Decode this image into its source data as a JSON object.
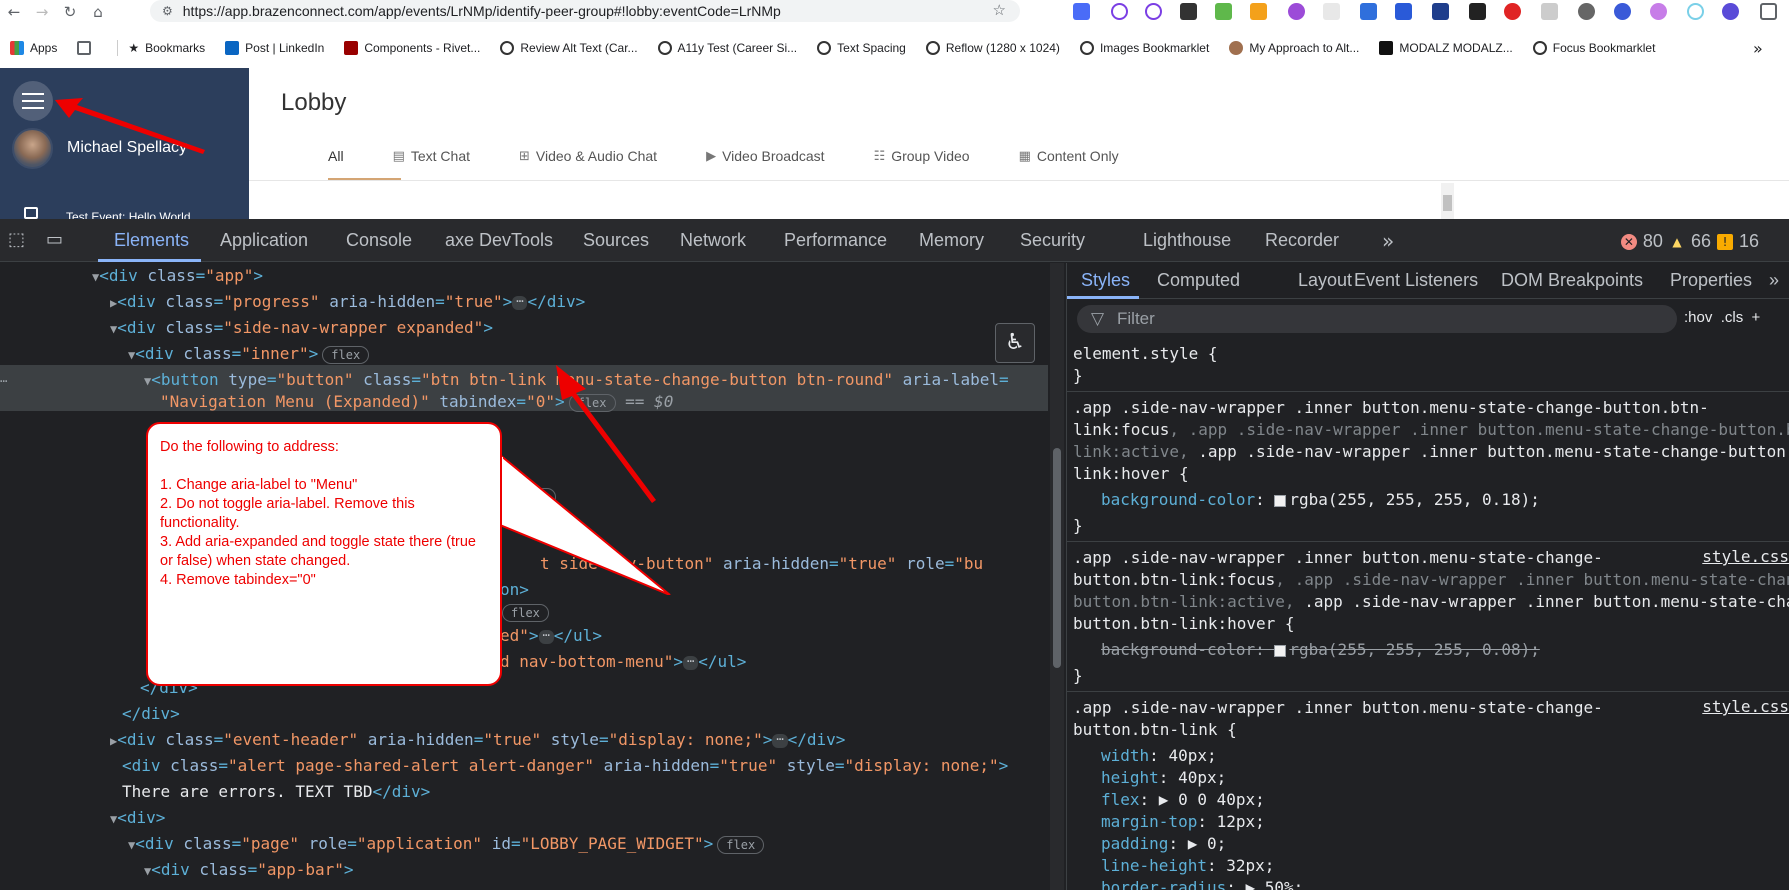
{
  "browser": {
    "url": "https://app.brazenconnect.com/app/events/LrNMp/identify-peer-group#!lobby:eventCode=LrNMp",
    "bookmarks": [
      "Apps",
      "Bookmarks",
      "Post | LinkedIn",
      "Components - Rivet...",
      "Review Alt Text (Car...",
      "A11y Test (Career Si...",
      "Text Spacing",
      "Reflow (1280 x 1024)",
      "Images Bookmarklet",
      "My Approach to Alt...",
      "MODALZ MODALZ...",
      "Focus Bookmarklet"
    ]
  },
  "app": {
    "user_name": "Michael Spellacy",
    "event_name": "Test Event: Hello World",
    "page_title": "Lobby",
    "tabs": [
      {
        "label": "All",
        "icon": ""
      },
      {
        "label": "Text Chat",
        "icon": "chat-icon"
      },
      {
        "label": "Video & Audio Chat",
        "icon": "video-chat-icon"
      },
      {
        "label": "Video Broadcast",
        "icon": "broadcast-icon"
      },
      {
        "label": "Group Video",
        "icon": "group-icon"
      },
      {
        "label": "Content Only",
        "icon": "document-icon"
      }
    ]
  },
  "devtools": {
    "tabs": [
      "Elements",
      "Application",
      "Console",
      "axe DevTools",
      "Sources",
      "Network",
      "Performance",
      "Memory",
      "Security",
      "Lighthouse",
      "Recorder"
    ],
    "errors": "80",
    "warnings": "66",
    "issues": "16",
    "styles_tabs": [
      "Styles",
      "Computed",
      "Layout",
      "Event Listeners",
      "DOM Breakpoints",
      "Properties"
    ],
    "filter_placeholder": "Filter",
    "hov": ":hov",
    "cls": ".cls",
    "source": "style.css"
  },
  "callout": {
    "heading": "Do the following to address:",
    "items": [
      "1. Change aria-label to \"Menu\"",
      "2. Do not toggle aria-label. Remove this functionality.",
      "3. Add aria-expanded and toggle state there (true or false) when state changed.",
      "4. Remove tabindex=\"0\""
    ]
  },
  "colors": {
    "sidenav": "#2c3e5c",
    "devtools_bg": "#202124",
    "accent": "#8ab4f8",
    "callout_red": "#ee0000"
  }
}
